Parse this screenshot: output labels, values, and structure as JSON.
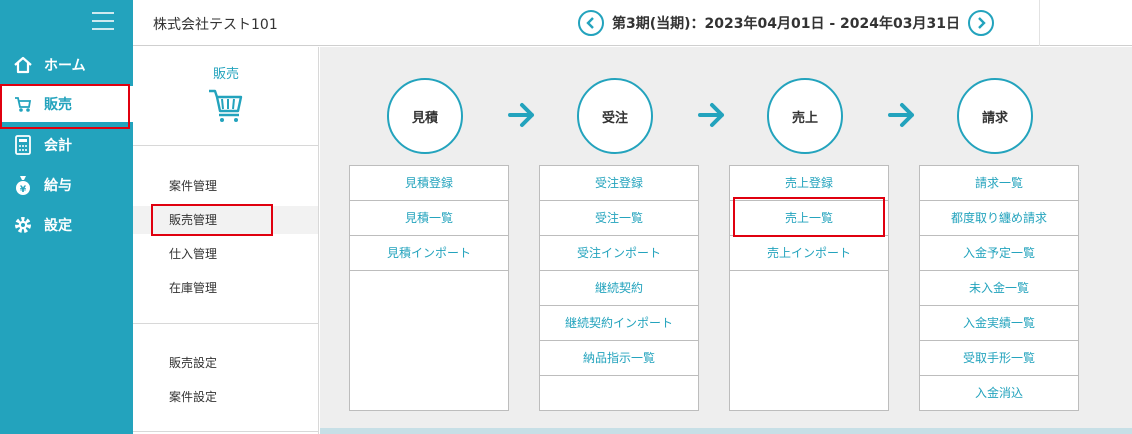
{
  "nav": {
    "items": [
      {
        "label": "ホーム",
        "icon": "home-icon"
      },
      {
        "label": "販売",
        "icon": "cart-icon"
      },
      {
        "label": "会計",
        "icon": "calculator-icon"
      },
      {
        "label": "給与",
        "icon": "money-bag-icon"
      },
      {
        "label": "設定",
        "icon": "gear-icon"
      }
    ],
    "active": "販売"
  },
  "header": {
    "company": "株式会社テスト101",
    "period": "第3期(当期)：2023年04月01日 - 2024年03月31日"
  },
  "category": {
    "title": "販売",
    "group1": [
      "案件管理",
      "販売管理",
      "仕入管理",
      "在庫管理"
    ],
    "group2": [
      "販売設定",
      "案件設定"
    ],
    "selected": "販売管理"
  },
  "flow": {
    "steps": [
      "見積",
      "受注",
      "売上",
      "請求"
    ],
    "columns": [
      [
        "見積登録",
        "見積一覧",
        "見積インポート"
      ],
      [
        "受注登録",
        "受注一覧",
        "受注インポート",
        "継続契約",
        "継続契約インポート",
        "納品指示一覧"
      ],
      [
        "売上登録",
        "売上一覧",
        "売上インポート"
      ],
      [
        "請求一覧",
        "都度取り纏め請求",
        "入金予定一覧",
        "未入金一覧",
        "入金実績一覧",
        "受取手形一覧",
        "入金消込"
      ]
    ]
  },
  "colors": {
    "accent": "#23a3bd",
    "highlight": "#e0000f",
    "main_bg": "#eeeeee"
  }
}
